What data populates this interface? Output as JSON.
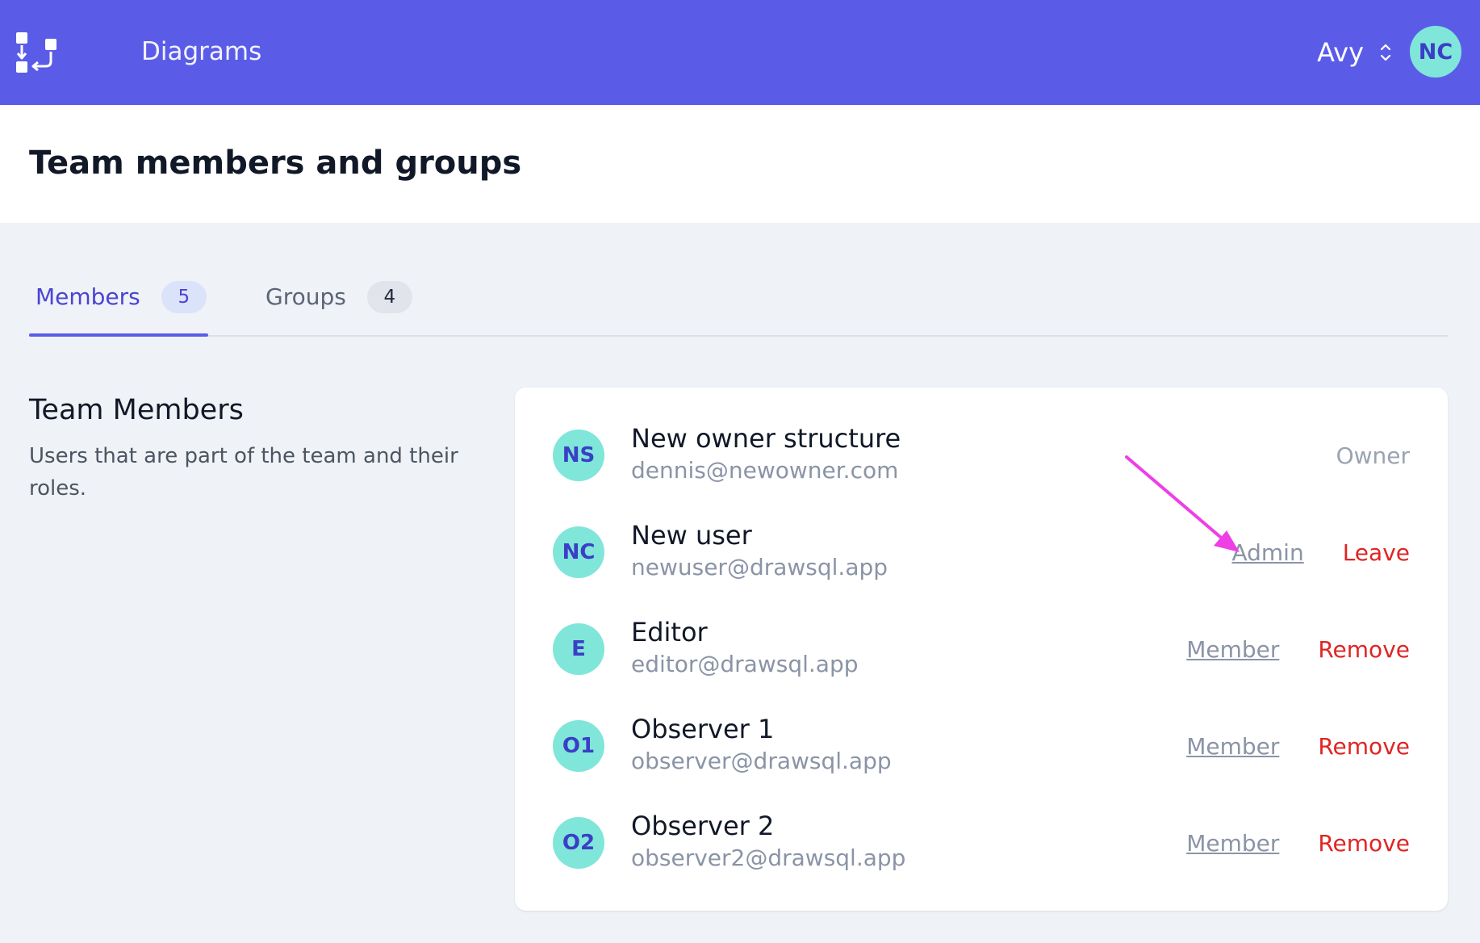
{
  "topbar": {
    "logo_icon": "diagram-flow-icon",
    "nav_diagrams": "Diagrams",
    "team_name": "Avy",
    "team_switcher_icon": "chevron-up-down-icon",
    "user_initials": "NC",
    "brand_color": "#5a5ce8"
  },
  "page": {
    "title": "Team members and groups"
  },
  "tabs": {
    "members": {
      "label": "Members",
      "count": "5"
    },
    "groups": {
      "label": "Groups",
      "count": "4"
    }
  },
  "section": {
    "title": "Team Members",
    "description": "Users that are part of the team and their roles."
  },
  "members": [
    {
      "initials": "NS",
      "name": "New owner structure",
      "email": "dennis@newowner.com",
      "role": "Owner",
      "action": ""
    },
    {
      "initials": "NC",
      "name": "New user",
      "email": "newuser@drawsql.app",
      "role": "Admin",
      "action": "Leave"
    },
    {
      "initials": "E",
      "name": "Editor",
      "email": "editor@drawsql.app",
      "role": "Member",
      "action": "Remove"
    },
    {
      "initials": "O1",
      "name": "Observer 1",
      "email": "observer@drawsql.app",
      "role": "Member",
      "action": "Remove"
    },
    {
      "initials": "O2",
      "name": "Observer 2",
      "email": "observer2@drawsql.app",
      "role": "Member",
      "action": "Remove"
    }
  ],
  "colors": {
    "avatar_bg": "#7fe6d9",
    "avatar_text": "#3b3ec6",
    "danger": "#e02424",
    "annotation_arrow": "#ee3fe6"
  }
}
